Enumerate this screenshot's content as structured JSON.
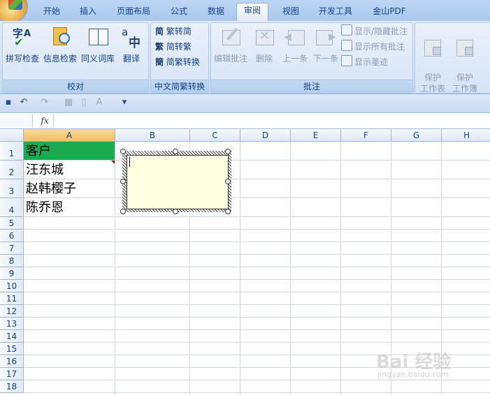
{
  "tabs": [
    {
      "label": "开始",
      "active": false
    },
    {
      "label": "插入",
      "active": false
    },
    {
      "label": "页面布局",
      "active": false
    },
    {
      "label": "公式",
      "active": false
    },
    {
      "label": "数据",
      "active": false
    },
    {
      "label": "审阅",
      "active": true
    },
    {
      "label": "视图",
      "active": false
    },
    {
      "label": "开发工具",
      "active": false
    },
    {
      "label": "金山PDF",
      "active": false
    }
  ],
  "groups": {
    "proofing": {
      "label": "校对",
      "buttons": [
        "拼写检查",
        "信息检索",
        "同义词库",
        "翻译"
      ]
    },
    "chinese": {
      "label": "中文简繁转换",
      "buttons": [
        "繁转简",
        "简转繁",
        "简繁转换"
      ]
    },
    "comments": {
      "label": "批注",
      "buttons": [
        "编辑批注",
        "删除",
        "上一条",
        "下一条"
      ],
      "small": [
        "显示/隐藏批注",
        "显示所有批注",
        "显示墨迹"
      ]
    },
    "changes": {
      "buttons": [
        "保护\n工作表",
        "保护\n工作簿"
      ]
    }
  },
  "formula_bar": {
    "fx": "fx",
    "value": ""
  },
  "columns": [
    "A",
    "B",
    "C",
    "D",
    "E",
    "F",
    "G",
    "H"
  ],
  "rows": [
    "1",
    "2",
    "3",
    "4",
    "5",
    "6",
    "7",
    "8",
    "9",
    "10",
    "11",
    "12",
    "13",
    "14",
    "15",
    "16",
    "17",
    "18"
  ],
  "cells": {
    "A1": "客户",
    "A2": "汪东城",
    "A3": "赵韩樱子",
    "A4": "陈乔恩"
  },
  "comment": {
    "text": ""
  },
  "colors": {
    "header_green": "#1aaa4f",
    "comment_bg": "#ffffe1",
    "ribbon_text": "#15428b"
  },
  "watermark": {
    "main": "Bai 经验",
    "sub": "jingyan.baidu.com"
  }
}
